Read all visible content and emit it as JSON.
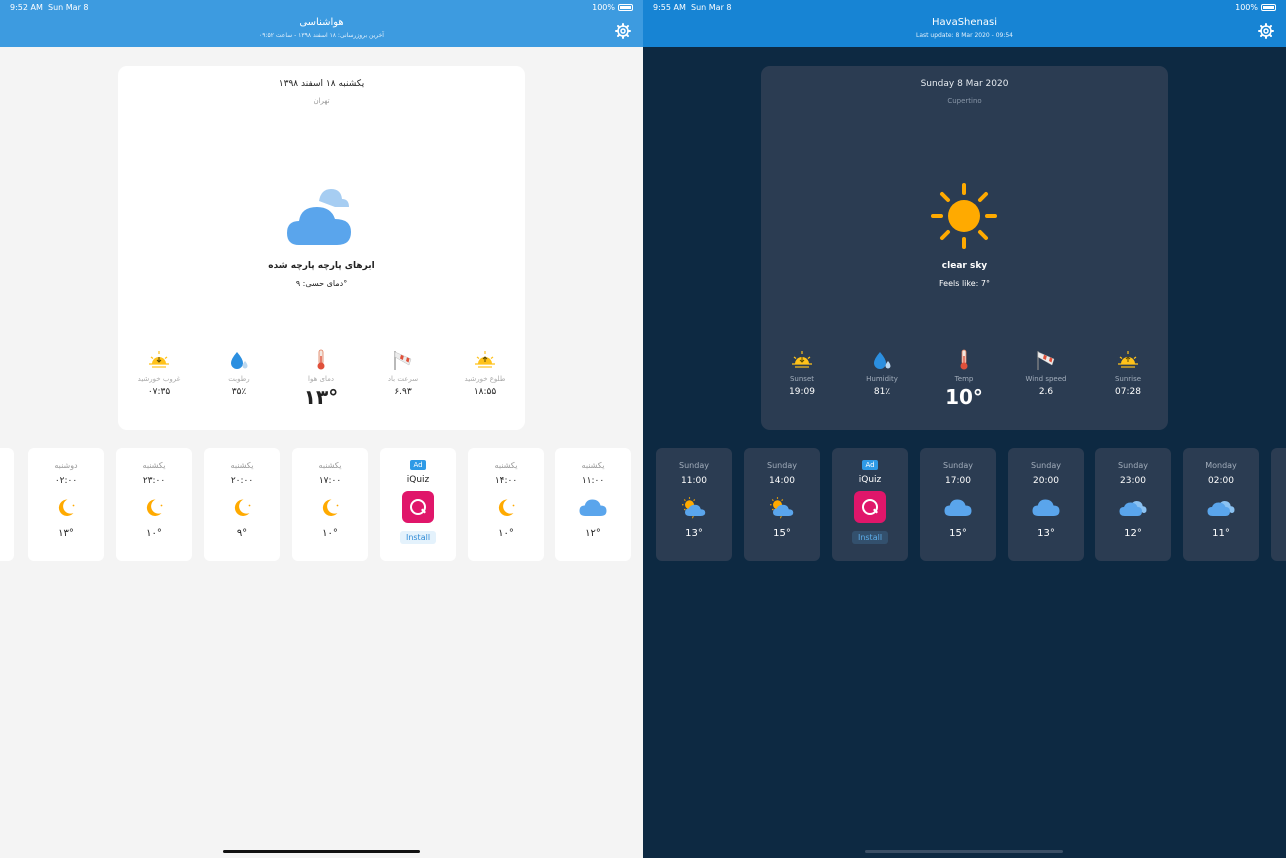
{
  "colors": {
    "light_header": "#3d9be0",
    "dark_header": "#1784d4",
    "dark_bg": "#0d2942",
    "dark_card": "#2b3c52",
    "sun": "#ffaa00",
    "cloud": "#5aa5ec",
    "ad_badge": "#2e9ae6",
    "ad_logo": "#e0166a"
  },
  "light": {
    "status": {
      "time": "9:52 AM",
      "date": "Sun Mar 8",
      "battery": "100%"
    },
    "header": {
      "title": "هواشناسی",
      "subtitle": "آخرین بروزرسانی: ۱۸ اسفند ۱۳۹۸ - ساعت ۰۹:۵۲"
    },
    "card": {
      "date": "یکشنبه ۱۸ اسفند ۱۳۹۸",
      "city": "تهران",
      "icon": "partly-cloudy-icon",
      "description": "ابرهای پارچه پارچه شده",
      "feels_like": "دمای حسی: ۹°",
      "stats": [
        {
          "icon": "sunset-icon",
          "label": "غروب خورشید",
          "value": "۰۷:۳۵"
        },
        {
          "icon": "humidity-icon",
          "label": "رطوبت",
          "value": "۳۵٪"
        },
        {
          "icon": "thermometer-icon",
          "label": "دمای هوا",
          "value": "۱۳°"
        },
        {
          "icon": "wind-icon",
          "label": "سرعت باد",
          "value": "۶.۹۳"
        },
        {
          "icon": "sunrise-icon",
          "label": "طلوع خورشید",
          "value": "۱۸:۵۵"
        }
      ]
    },
    "hourly": [
      {
        "day": "دوشنبه",
        "time": "۰۲:۰۰",
        "icon": "moon-icon",
        "temp": "۱۳°"
      },
      {
        "day": "یکشنبه",
        "time": "۲۳:۰۰",
        "icon": "moon-icon",
        "temp": "۱۰°"
      },
      {
        "day": "یکشنبه",
        "time": "۲۰:۰۰",
        "icon": "moon-icon",
        "temp": "۹°"
      },
      {
        "day": "یکشنبه",
        "time": "۱۷:۰۰",
        "icon": "moon-icon",
        "temp": "۱۰°"
      },
      {
        "day": "یکشنبه",
        "time": "۱۴:۰۰",
        "icon": "moon-icon",
        "temp": "۱۰°"
      },
      {
        "day": "یکشنبه",
        "time": "۱۱:۰۰",
        "icon": "cloud-icon",
        "temp": "۱۲°"
      }
    ],
    "ad": {
      "tag": "Ad",
      "name": "iQuiz",
      "button": "Install"
    }
  },
  "dark": {
    "status": {
      "time": "9:55 AM",
      "date": "Sun Mar 8",
      "battery": "100%"
    },
    "header": {
      "title": "HavaShenasi",
      "subtitle": "Last update: 8 Mar 2020 - 09:54"
    },
    "card": {
      "date": "Sunday 8 Mar 2020",
      "city": "Cupertino",
      "icon": "sun-icon",
      "description": "clear sky",
      "feels_like": "Feels like: 7°",
      "stats": [
        {
          "icon": "sunset-icon",
          "label": "Sunset",
          "value": "19:09"
        },
        {
          "icon": "humidity-icon",
          "label": "Humidity",
          "value": "81٪"
        },
        {
          "icon": "thermometer-icon",
          "label": "Temp",
          "value": "10°"
        },
        {
          "icon": "wind-icon",
          "label": "Wind speed",
          "value": "2.6"
        },
        {
          "icon": "sunrise-icon",
          "label": "Sunrise",
          "value": "07:28"
        }
      ]
    },
    "hourly": [
      {
        "day": "Sunday",
        "time": "11:00",
        "icon": "sun-cloud-icon",
        "temp": "13°"
      },
      {
        "day": "Sunday",
        "time": "14:00",
        "icon": "sun-cloud-icon",
        "temp": "15°"
      },
      {
        "day": "Sunday",
        "time": "17:00",
        "icon": "cloud-icon",
        "temp": "15°"
      },
      {
        "day": "Sunday",
        "time": "20:00",
        "icon": "cloud-icon",
        "temp": "13°"
      },
      {
        "day": "Sunday",
        "time": "23:00",
        "icon": "clouds-icon",
        "temp": "12°"
      },
      {
        "day": "Monday",
        "time": "02:00",
        "icon": "clouds-icon",
        "temp": "11°"
      }
    ],
    "ad": {
      "tag": "Ad",
      "name": "iQuiz",
      "button": "Install"
    }
  }
}
